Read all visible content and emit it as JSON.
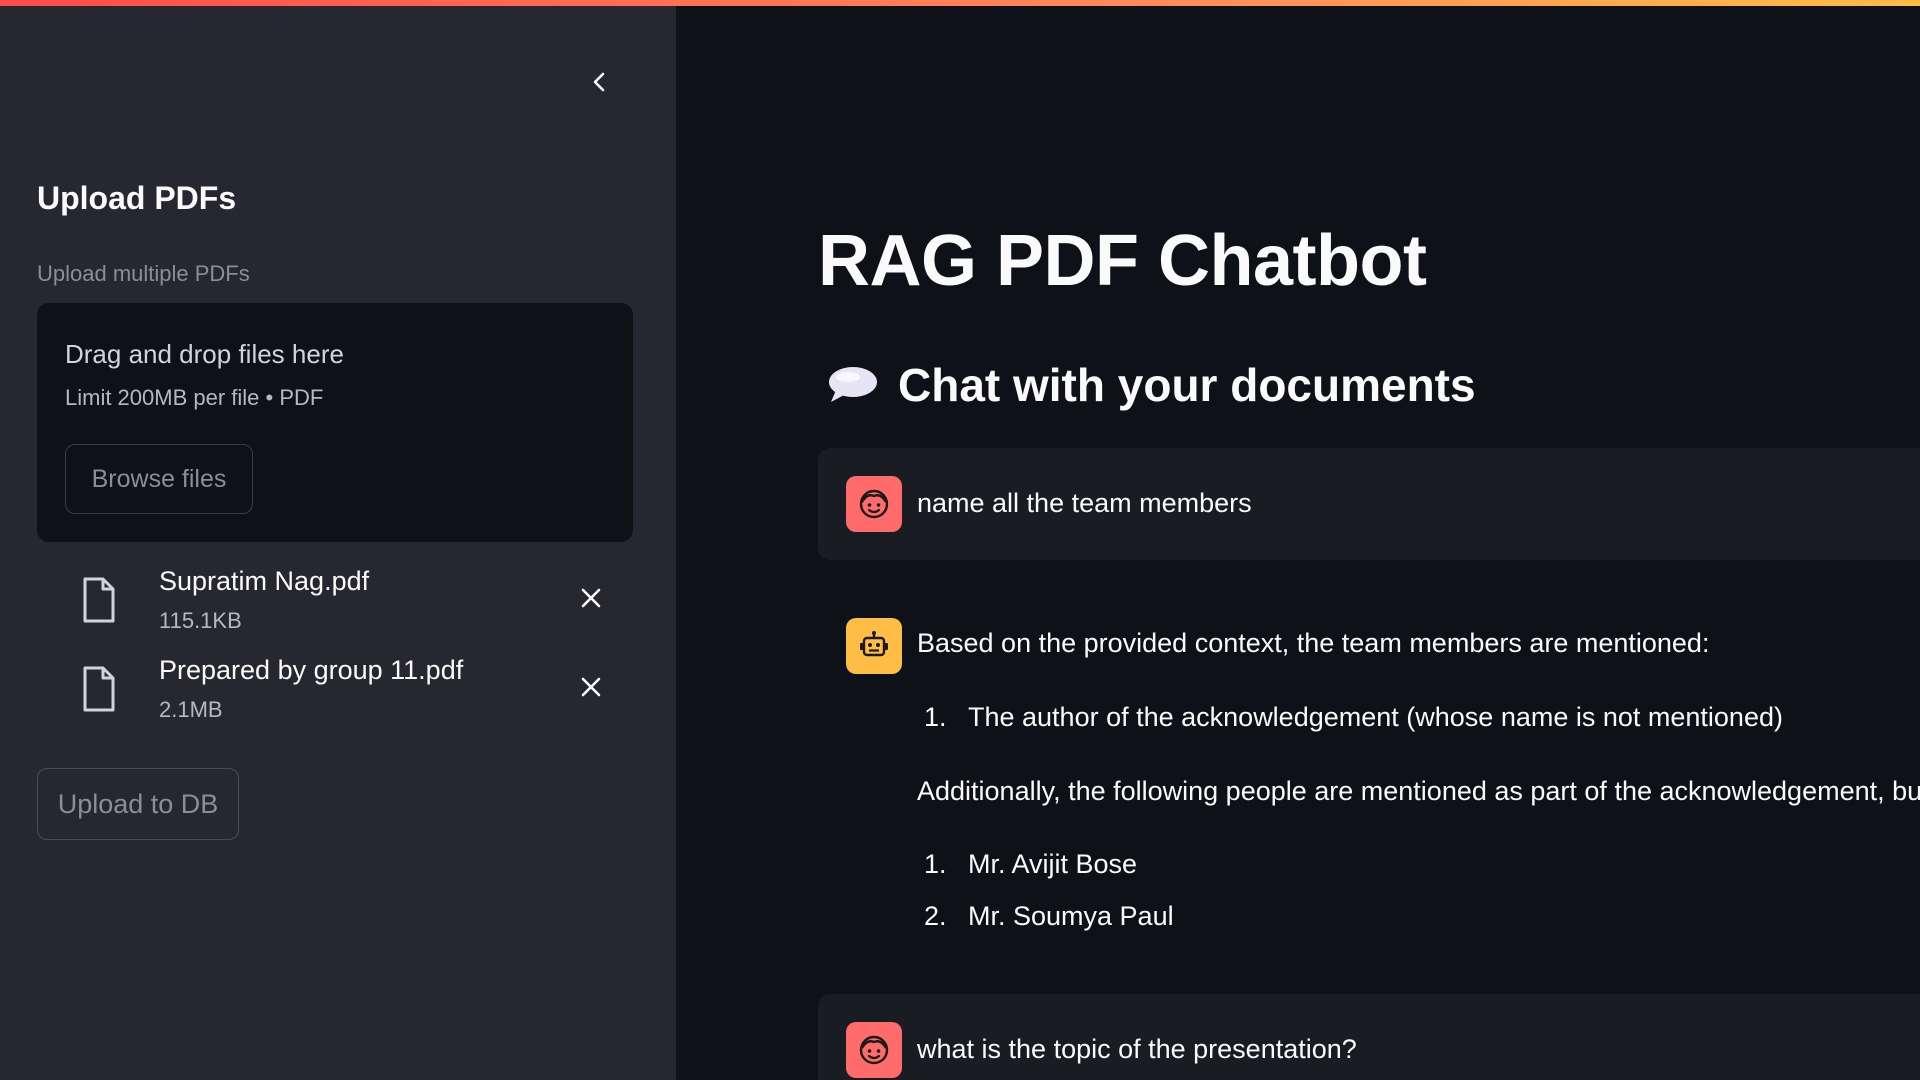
{
  "sidebar": {
    "collapse_icon": "chevron-left-icon",
    "heading": "Upload PDFs",
    "uploader_label": "Upload multiple PDFs",
    "dropzone": {
      "title": "Drag and drop files here",
      "limit": "Limit 200MB per file • PDF",
      "browse_label": "Browse files"
    },
    "files": [
      {
        "name": "Supratim Nag.pdf",
        "size": "115.1KB",
        "icon": "file-icon",
        "remove_icon": "close-icon"
      },
      {
        "name": "Prepared by group 11.pdf",
        "size": "2.1MB",
        "icon": "file-icon",
        "remove_icon": "close-icon"
      }
    ],
    "upload_button": "Upload to DB"
  },
  "main": {
    "title": "RAG PDF Chatbot",
    "subheader": {
      "icon": "speech-bubble-icon",
      "text": "Chat with your documents"
    },
    "messages": [
      {
        "role": "user",
        "avatar": "user-face-icon",
        "text": "name all the team members"
      },
      {
        "role": "assistant",
        "avatar": "robot-icon",
        "intro": "Based on the provided context, the team members are mentioned:",
        "list1": [
          {
            "num": "1.",
            "text": "The author of the acknowledgement (whose name is not mentioned)"
          }
        ],
        "middle": "Additionally, the following people are mentioned as part of the acknowledgement, bu",
        "list2": [
          {
            "num": "1.",
            "text": "Mr. Avijit Bose"
          },
          {
            "num": "2.",
            "text": "Mr. Soumya Paul"
          }
        ]
      },
      {
        "role": "user",
        "avatar": "user-face-icon",
        "text": "what is the topic of the presentation?"
      }
    ]
  },
  "colors": {
    "accent_red": "#ff4b4b",
    "user_avatar": "#ff6b6b",
    "bot_avatar": "#ffbd45",
    "sidebar_bg": "#262730",
    "main_bg": "#0e1117"
  }
}
